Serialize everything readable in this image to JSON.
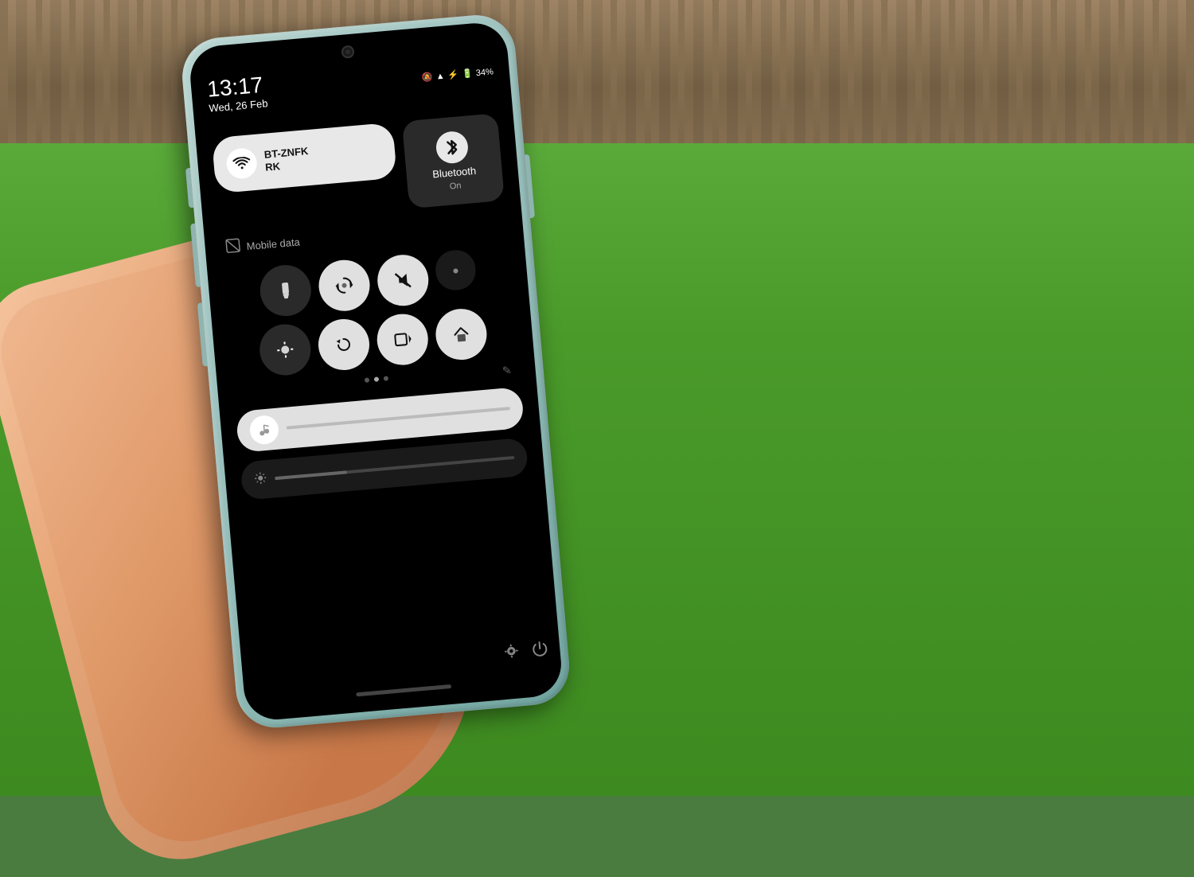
{
  "background": {
    "grass_color": "#4a7c3f",
    "fence_color": "#8B7355"
  },
  "phone": {
    "color": "#a0c4c0",
    "screen_bg": "#000000"
  },
  "status_bar": {
    "time": "13:17",
    "date": "Wed, 26 Feb",
    "battery": "34%",
    "icons": "🔕 📶 ⚡"
  },
  "quick_settings": {
    "wifi_tile": {
      "name": "BT-ZNFKRK",
      "sub_label": "",
      "icon": "📶"
    },
    "bluetooth_tile": {
      "label": "Bluetooth",
      "status": "On",
      "icon": "⬡"
    },
    "mobile_data": {
      "label": "Mobile data",
      "icon": "📵"
    },
    "tiles_row2": [
      {
        "icon": "🔦",
        "active": false,
        "label": "flashlight"
      },
      {
        "icon": "◉",
        "active": true,
        "label": "screen-rotate"
      },
      {
        "icon": "🔕",
        "active": true,
        "label": "mute"
      },
      {
        "icon": "◐",
        "active": false,
        "label": "color-correction"
      }
    ],
    "tiles_row3": [
      {
        "icon": "☀",
        "active": false,
        "label": "brightness"
      },
      {
        "icon": "⟳",
        "active": true,
        "label": "auto-rotate"
      },
      {
        "icon": "⬛",
        "active": true,
        "label": "screen-record"
      },
      {
        "icon": "⌂",
        "active": true,
        "label": "home"
      }
    ],
    "dots": [
      {
        "active": false
      },
      {
        "active": true
      },
      {
        "active": false
      }
    ],
    "brightness_level": 30
  },
  "icons": {
    "bluetooth": "✱",
    "wifi": "≋",
    "settings": "⚙",
    "power": "⏻",
    "edit": "✎",
    "flashlight": "🔦",
    "rotate": "↺",
    "mute": "🔕",
    "dot_notch": "●",
    "sun": "☀"
  }
}
